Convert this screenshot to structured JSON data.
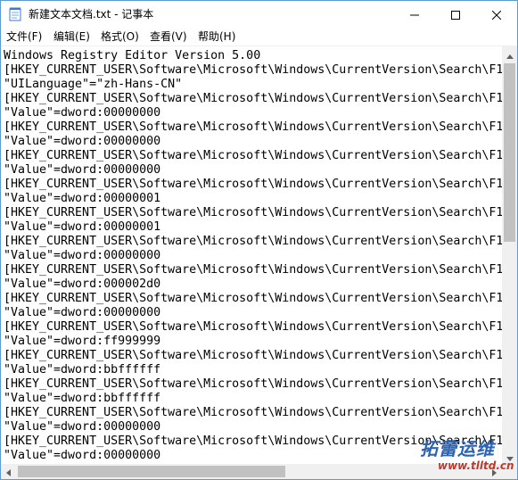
{
  "window": {
    "title": "新建文本文档.txt - 记事本"
  },
  "menu": [
    {
      "label": "文件(F)"
    },
    {
      "label": "编辑(E)"
    },
    {
      "label": "格式(O)"
    },
    {
      "label": "查看(V)"
    },
    {
      "label": "帮助(H)"
    }
  ],
  "editor": {
    "lines": [
      "Windows Registry Editor Version 5.00",
      "[HKEY_CURRENT_USER\\Software\\Microsoft\\Windows\\CurrentVersion\\Search\\F1",
      "\"UILanguage\"=\"zh-Hans-CN\"",
      "[HKEY_CURRENT_USER\\Software\\Microsoft\\Windows\\CurrentVersion\\Search\\F1",
      "\"Value\"=dword:00000000",
      "[HKEY_CURRENT_USER\\Software\\Microsoft\\Windows\\CurrentVersion\\Search\\F1",
      "\"Value\"=dword:00000000",
      "[HKEY_CURRENT_USER\\Software\\Microsoft\\Windows\\CurrentVersion\\Search\\F1",
      "\"Value\"=dword:00000000",
      "[HKEY_CURRENT_USER\\Software\\Microsoft\\Windows\\CurrentVersion\\Search\\F1",
      "\"Value\"=dword:00000001",
      "[HKEY_CURRENT_USER\\Software\\Microsoft\\Windows\\CurrentVersion\\Search\\F1",
      "\"Value\"=dword:00000001",
      "[HKEY_CURRENT_USER\\Software\\Microsoft\\Windows\\CurrentVersion\\Search\\F1",
      "\"Value\"=dword:00000000",
      "[HKEY_CURRENT_USER\\Software\\Microsoft\\Windows\\CurrentVersion\\Search\\F1",
      "\"Value\"=dword:000002d0",
      "[HKEY_CURRENT_USER\\Software\\Microsoft\\Windows\\CurrentVersion\\Search\\F1",
      "\"Value\"=dword:00000000",
      "[HKEY_CURRENT_USER\\Software\\Microsoft\\Windows\\CurrentVersion\\Search\\F1",
      "\"Value\"=dword:ff999999",
      "[HKEY_CURRENT_USER\\Software\\Microsoft\\Windows\\CurrentVersion\\Search\\F1",
      "\"Value\"=dword:bbffffff",
      "[HKEY_CURRENT_USER\\Software\\Microsoft\\Windows\\CurrentVersion\\Search\\F1",
      "\"Value\"=dword:bbffffff",
      "[HKEY_CURRENT_USER\\Software\\Microsoft\\Windows\\CurrentVersion\\Search\\F1",
      "\"Value\"=dword:00000000",
      "[HKEY_CURRENT_USER\\Software\\Microsoft\\Windows\\CurrentVersion\\Search\\F1",
      "\"Value\"=dword:00000000"
    ]
  },
  "watermark": {
    "brand": "拓蕾运维",
    "url": "www.tlltd.cn"
  },
  "colors": {
    "window_border": "#5b9bd5",
    "scrollbar_track": "#f0f0f0",
    "scrollbar_thumb": "#c1c1c1"
  },
  "icons": [
    "notepad-icon",
    "minimize-icon",
    "maximize-icon",
    "close-icon",
    "scroll-up-icon",
    "scroll-down-icon",
    "scroll-left-icon",
    "scroll-right-icon"
  ]
}
